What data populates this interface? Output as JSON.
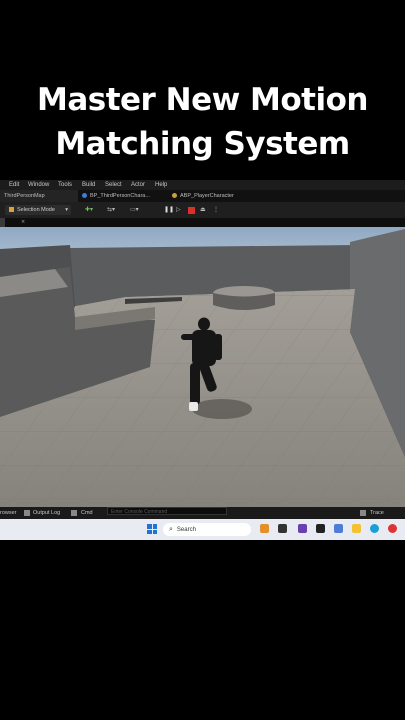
{
  "headline": {
    "line1": "Master New Motion",
    "line2": "Matching System"
  },
  "menu": [
    "Edit",
    "Window",
    "Tools",
    "Build",
    "Select",
    "Actor",
    "Help"
  ],
  "tabs": [
    "ThirdPersonMap",
    "BP_ThirdPersonChara...",
    "ABP_PlayerCharacter"
  ],
  "toolbar": {
    "selection_mode": "Selection Mode"
  },
  "viewport_tab_close": "×",
  "bottom": {
    "browser": "rowser",
    "output_log": "Output Log",
    "cmd": "Cmd",
    "console_placeholder": "Enter Console Command",
    "trace": "Trace"
  },
  "taskbar": {
    "search": "Search"
  },
  "colors": {
    "taskbar_bg": "#e8ecf2",
    "editor_bg": "#151515",
    "stop_button": "#d9302c",
    "play_button": "#3ba34a"
  },
  "icons": [
    "windows-start-icon",
    "search-icon",
    "file-explorer-icon",
    "edge-icon",
    "store-icon",
    "chrome-icon",
    "trace-icon"
  ]
}
